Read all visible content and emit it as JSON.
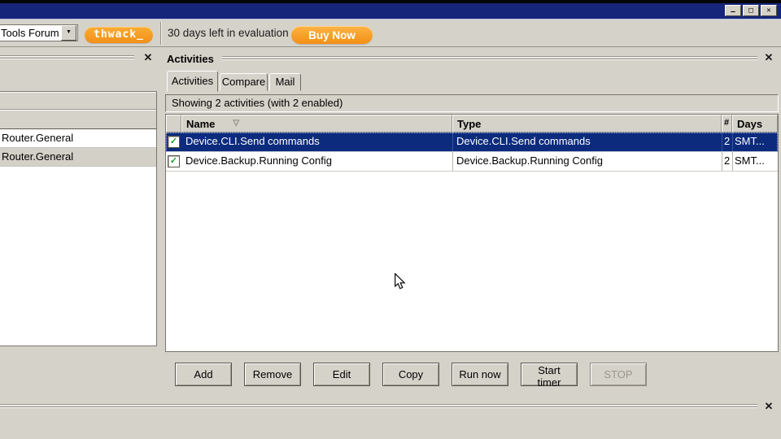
{
  "titlebar": {
    "minimize_icon": "—",
    "maximize_icon": "□",
    "close_icon": "✕"
  },
  "toolbar": {
    "forum_label": "Tools Forum",
    "dropdown_icon": "▼",
    "thwack_label": "thwack_",
    "eval_text": "30 days left in evaluation",
    "buy_now_label": "Buy Now"
  },
  "left_panel": {
    "close_icon": "✕",
    "rows": [
      "Router.General",
      "Router.General"
    ]
  },
  "activities": {
    "title": "Activities",
    "close_icon": "✕",
    "tabs": [
      "Activities",
      "Compare",
      "Mail"
    ],
    "active_tab": "Activities",
    "status": "Showing 2 activities (with 2 enabled)",
    "table": {
      "headers": {
        "name": "Name",
        "type": "Type",
        "count": "#",
        "days": "Days"
      },
      "sort_icon": "▽",
      "check_icon": "✓",
      "rows": [
        {
          "name": "Device.CLI.Send commands",
          "type": "Device.CLI.Send commands",
          "count": "2",
          "days": "SMT...",
          "checked": true,
          "selected": true
        },
        {
          "name": "Device.Backup.Running Config",
          "type": "Device.Backup.Running Config",
          "count": "2",
          "days": "SMT...",
          "checked": true,
          "selected": false
        }
      ]
    },
    "buttons": [
      {
        "label": "Add",
        "enabled": true
      },
      {
        "label": "Remove",
        "enabled": true
      },
      {
        "label": "Edit",
        "enabled": true
      },
      {
        "label": "Copy",
        "enabled": true
      },
      {
        "label": "Run now",
        "enabled": true
      },
      {
        "label": "Start timer",
        "enabled": true
      },
      {
        "label": "STOP",
        "enabled": false
      }
    ]
  },
  "bottom_panel": {
    "close_icon": "✕"
  },
  "colors": {
    "titlebar_blue": "#152579",
    "chrome_gray": "#d5d2c9",
    "accent_orange": "#f6941c",
    "selection_blue": "#0c2b7d",
    "check_green": "#1f9e2e"
  }
}
